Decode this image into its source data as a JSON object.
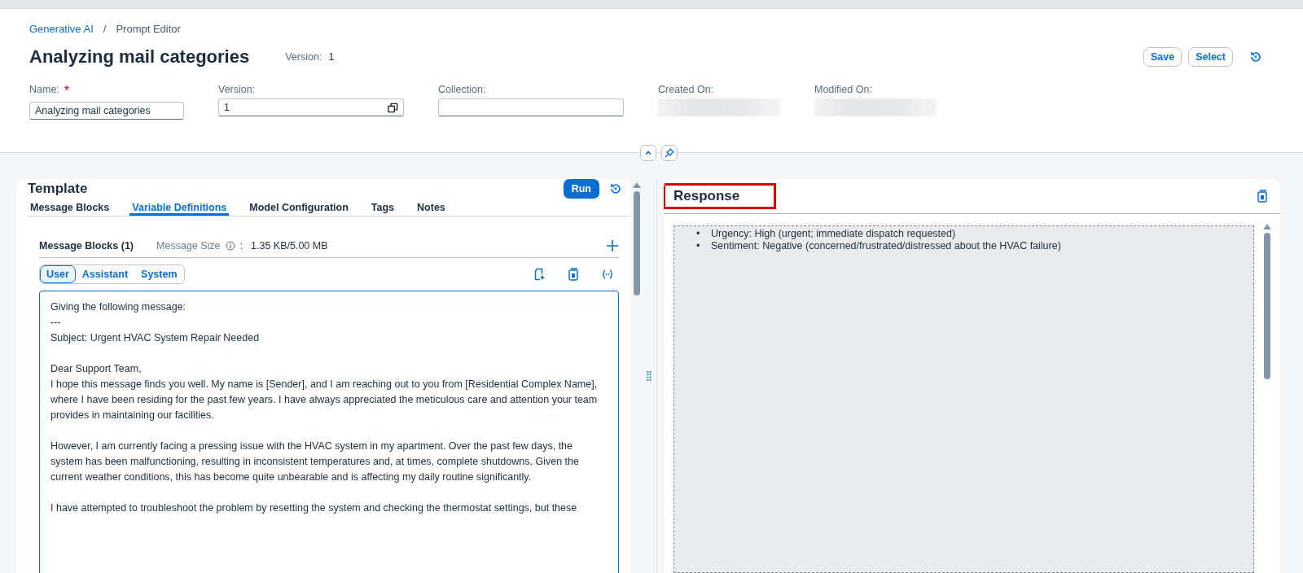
{
  "breadcrumbs": [
    {
      "label": "Generative AI",
      "link": true
    },
    {
      "label": "Prompt Editor",
      "link": false
    }
  ],
  "breadcrumb_separator": "/",
  "header": {
    "title": "Analyzing mail categories",
    "version_label": "Version:",
    "version_value": "1",
    "buttons": [
      "Save",
      "Select"
    ]
  },
  "required_mark": "*",
  "fields": [
    {
      "label": "Name:",
      "required": true,
      "value": "Analyzing mail categories",
      "kind": "text"
    },
    {
      "label": "Version:",
      "required": false,
      "value": "1",
      "kind": "copy"
    },
    {
      "label": "Collection:",
      "required": false,
      "kind": "text"
    },
    {
      "label": "Created On:",
      "required": false,
      "kind": "redacted"
    },
    {
      "label": "Modified On:",
      "required": false,
      "kind": "redacted"
    }
  ],
  "template": {
    "title": "Template",
    "run_label": "Run",
    "tabs": [
      {
        "label": "Message Blocks",
        "selected": false
      },
      {
        "label": "Variable Definitions",
        "selected": true
      },
      {
        "label": "Model Configuration",
        "selected": false
      },
      {
        "label": "Tags",
        "selected": false
      },
      {
        "label": "Notes",
        "selected": false
      }
    ],
    "blocks_title": "Message Blocks (1)",
    "size_label": "Message Size",
    "size_separator": ":",
    "size_value": "1.35 KB/5.00 MB",
    "roles": [
      {
        "label": "User",
        "selected": true
      },
      {
        "label": "Assistant",
        "selected": false
      },
      {
        "label": "System",
        "selected": false
      }
    ],
    "message": [
      "Giving the following message:\n---\nSubject: Urgent HVAC System Repair Needed",
      "Dear Support Team,\nI hope this message finds you well. My name is [Sender], and I am reaching out to you from [Residential Complex Name], where I have been residing for the past few years. I have always appreciated the meticulous care and attention your team provides in maintaining our facilities.",
      "However, I am currently facing a pressing issue with the HVAC system in my apartment. Over the past few days, the system has been malfunctioning, resulting in inconsistent temperatures and, at times, complete shutdowns. Given the current weather conditions, this has become quite unbearable and is affecting my daily routine significantly.",
      "I have attempted to troubleshoot the problem by resetting the system and checking the thermostat settings, but these"
    ]
  },
  "response": {
    "title": "Response",
    "highlighted": true,
    "bullet": "•",
    "items": [
      "Urgency: High (urgent; immediate dispatch requested)",
      "Sentiment: Negative (concerned/frustrated/distressed about the HVAC failure)"
    ]
  }
}
